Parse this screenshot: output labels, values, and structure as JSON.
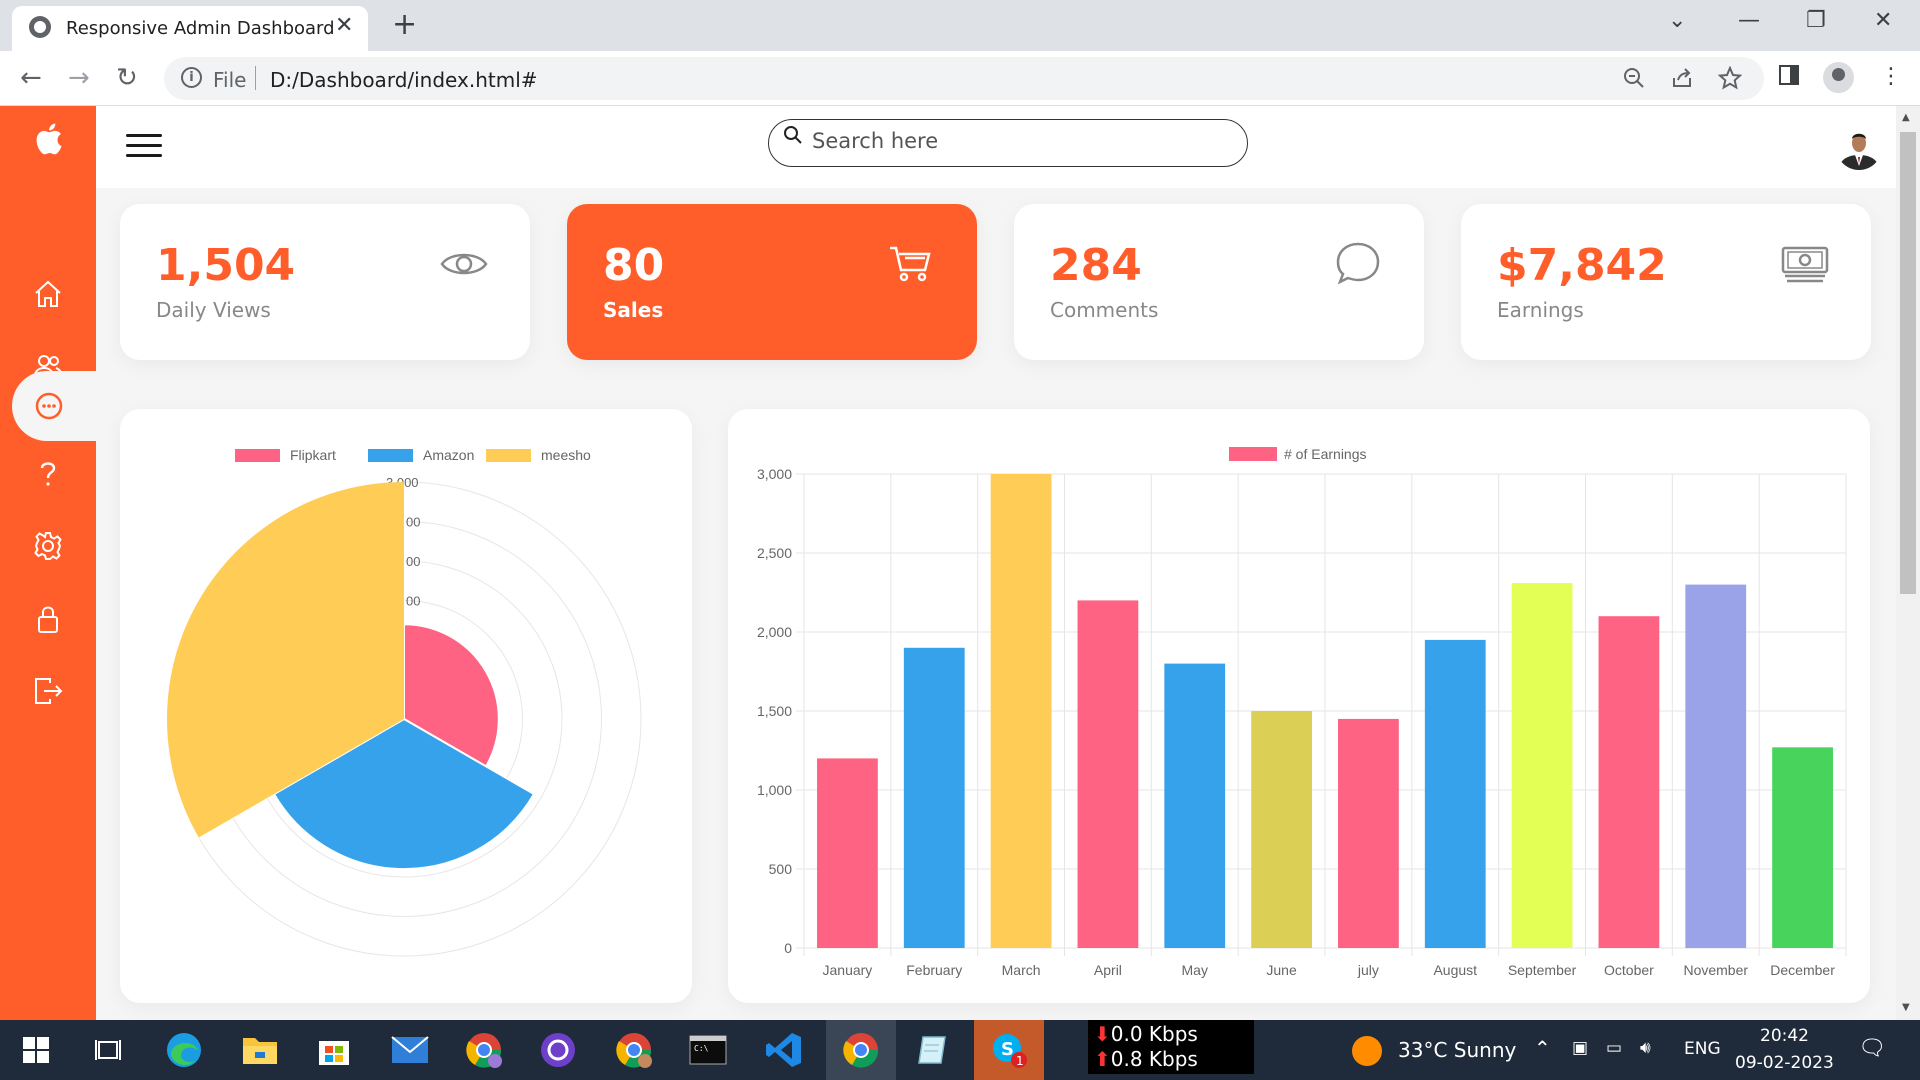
{
  "browser": {
    "tab_title": "Responsive Admin Dashboard",
    "omnibox_scheme": "File",
    "omnibox_url": "D:/Dashboard/index.html#"
  },
  "header": {
    "search_placeholder": "Search here"
  },
  "cards": [
    {
      "number": "1,504",
      "label": "Daily Views",
      "icon": "eye-icon"
    },
    {
      "number": "80",
      "label": "Sales",
      "icon": "cart-icon"
    },
    {
      "number": "284",
      "label": "Comments",
      "icon": "chat-icon"
    },
    {
      "number": "$7,842",
      "label": "Earnings",
      "icon": "cash-icon"
    }
  ],
  "sidebar": {
    "items": [
      {
        "icon": "home-icon"
      },
      {
        "icon": "users-icon"
      },
      {
        "icon": "message-icon",
        "active": true
      },
      {
        "icon": "help-icon"
      },
      {
        "icon": "settings-icon"
      },
      {
        "icon": "lock-icon"
      },
      {
        "icon": "logout-icon"
      }
    ]
  },
  "colors": {
    "accent": "#ff5e2b",
    "pink": "#ff6384",
    "blue": "#36a2eb",
    "yellow": "#ffcd56"
  },
  "chart_data": [
    {
      "type": "polarArea",
      "series": [
        {
          "name": "Flipkart",
          "value": 1200,
          "color": "#ff6384"
        },
        {
          "name": "Amazon",
          "value": 1900,
          "color": "#36a2eb"
        },
        {
          "name": "meesho",
          "value": 3000,
          "color": "#ffcd56"
        }
      ],
      "rlim": [
        0,
        3000
      ],
      "r_ticks": [
        0,
        500,
        1000,
        1500,
        2000,
        2500,
        3000
      ],
      "r_tick_labels_visible": [
        "3,000",
        "00",
        "00",
        "00"
      ],
      "legend_placement": "top"
    },
    {
      "type": "bar",
      "series_name": "# of Earnings",
      "categories": [
        "January",
        "February",
        "March",
        "April",
        "May",
        "June",
        "july",
        "August",
        "September",
        "October",
        "November",
        "December"
      ],
      "values": [
        1200,
        1900,
        3000,
        2200,
        1800,
        1500,
        1450,
        1950,
        2310,
        2100,
        2300,
        1270
      ],
      "colors": [
        "#ff6384",
        "#36a2eb",
        "#ffcd56",
        "#ff6384",
        "#36a2eb",
        "#dbcf55",
        "#ff6384",
        "#36a2eb",
        "#e3ff55",
        "#ff6384",
        "#9aa3e8",
        "#47d35c"
      ],
      "y_ticks": [
        0,
        500,
        1000,
        1500,
        2000,
        2500,
        3000
      ],
      "y_tick_labels": [
        "0",
        "500",
        "1,000",
        "1,500",
        "2,000",
        "2,500",
        "3,000"
      ],
      "ylim": [
        0,
        3000
      ],
      "grid": true,
      "legend_placement": "top"
    }
  ],
  "taskbar": {
    "net_down": "0.0 Kbps",
    "net_up": "0.8 Kbps",
    "weather": "33°C  Sunny",
    "lang": "ENG",
    "time": "20:42",
    "date": "09-02-2023",
    "badge_count": "1"
  }
}
